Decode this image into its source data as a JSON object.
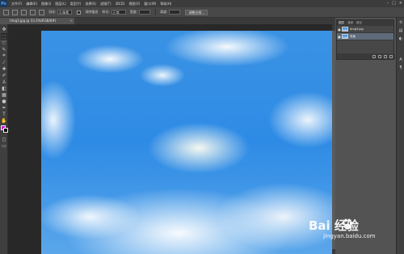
{
  "app": {
    "logo": "Ps"
  },
  "menu": [
    "文件(F)",
    "编辑(E)",
    "图像(I)",
    "图层(L)",
    "类型(Y)",
    "选择(S)",
    "滤镜(T)",
    "3D(D)",
    "视图(V)",
    "窗口(W)",
    "帮助(H)"
  ],
  "window_controls": [
    "–",
    "□",
    "×"
  ],
  "options": {
    "feather_label": "羽化:",
    "feather_value": "0 像素",
    "antialias_label": "消除锯齿",
    "style_label": "样式:",
    "style_value": "正常",
    "width_label": "宽度:",
    "height_label": "高度:",
    "refine_button": "调整边缘..."
  },
  "document": {
    "tab_title": "timg3.jpg @ 33.3%(RGB/8#)",
    "close": "×"
  },
  "colors": {
    "foreground": "#d400d4",
    "background": "#000000"
  },
  "tools": [
    "move-icon",
    "marquee-icon",
    "lasso-icon",
    "quick-select-icon",
    "crop-icon",
    "eyedropper-icon",
    "healing-icon",
    "brush-icon",
    "stamp-icon",
    "history-brush-icon",
    "eraser-icon",
    "gradient-icon",
    "blur-icon",
    "dodge-icon",
    "pen-icon",
    "type-icon",
    "path-select-icon",
    "shape-icon",
    "hand-icon",
    "zoom-icon"
  ],
  "layers_panel": {
    "tabs": [
      "图层",
      "通道",
      "路径"
    ],
    "layers": [
      {
        "name": "timg3.jpg",
        "visible_glyph": "●"
      },
      {
        "name": "背景",
        "visible_glyph": "●"
      }
    ]
  },
  "watermark": {
    "main": "Bai  经验",
    "sub": "jingyan.baidu.com"
  }
}
